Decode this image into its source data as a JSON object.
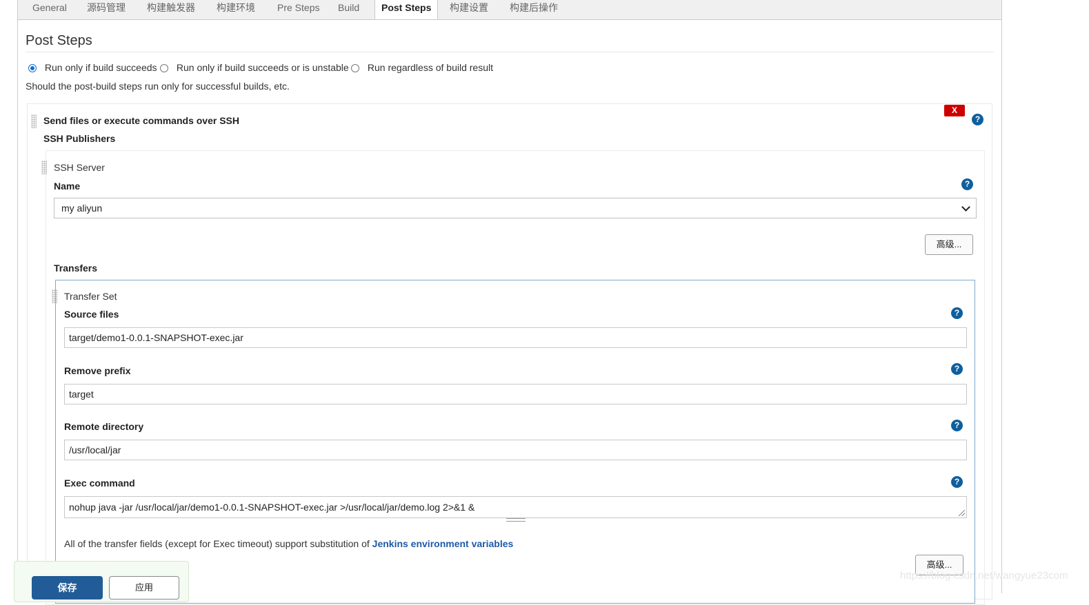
{
  "tabs": [
    {
      "label": "General",
      "active": false
    },
    {
      "label": "源码管理",
      "active": false
    },
    {
      "label": "构建触发器",
      "active": false
    },
    {
      "label": "构建环境",
      "active": false
    },
    {
      "label": "Pre Steps",
      "active": false
    },
    {
      "label": "Build",
      "active": false
    },
    {
      "label": "Post Steps",
      "active": true
    },
    {
      "label": "构建设置",
      "active": false
    },
    {
      "label": "构建后操作",
      "active": false
    }
  ],
  "post_steps": {
    "title": "Post Steps",
    "options": [
      {
        "label": "Run only if build succeeds",
        "selected": true
      },
      {
        "label": "Run only if build succeeds or is unstable",
        "selected": false
      },
      {
        "label": "Run regardless of build result",
        "selected": false
      }
    ],
    "description": "Should the post-build steps run only for successful builds, etc."
  },
  "ssh_step": {
    "title": "Send files or execute commands over SSH",
    "delete_label": "X",
    "help": "?",
    "publishers_label": "SSH Publishers",
    "server": {
      "title": "SSH Server",
      "name_label": "Name",
      "name_value": "my aliyun",
      "advanced_label": "高级..."
    },
    "transfers_label": "Transfers",
    "transfer_set": {
      "title": "Transfer Set",
      "source_files_label": "Source files",
      "source_files_value": "target/demo1-0.0.1-SNAPSHOT-exec.jar",
      "remove_prefix_label": "Remove prefix",
      "remove_prefix_value": "target",
      "remote_directory_label": "Remote directory",
      "remote_directory_value": "/usr/local/jar",
      "exec_command_label": "Exec command",
      "exec_command_value": "nohup java -jar /usr/local/jar/demo1-0.0.1-SNAPSHOT-exec.jar >/usr/local/jar/demo.log 2>&1 &",
      "env_note": "All of the transfer fields (except for Exec timeout) support substitution of ",
      "env_link": "Jenkins environment variables",
      "advanced_label": "高级..."
    }
  },
  "footer": {
    "save_label": "保存",
    "apply_label": "应用"
  },
  "watermark": "https://blog.csdn.net/wangyue23com",
  "colors": {
    "accent": "#215c98",
    "danger": "#cc0000",
    "help": "#0f5f9e",
    "link": "#1e5aa8"
  }
}
